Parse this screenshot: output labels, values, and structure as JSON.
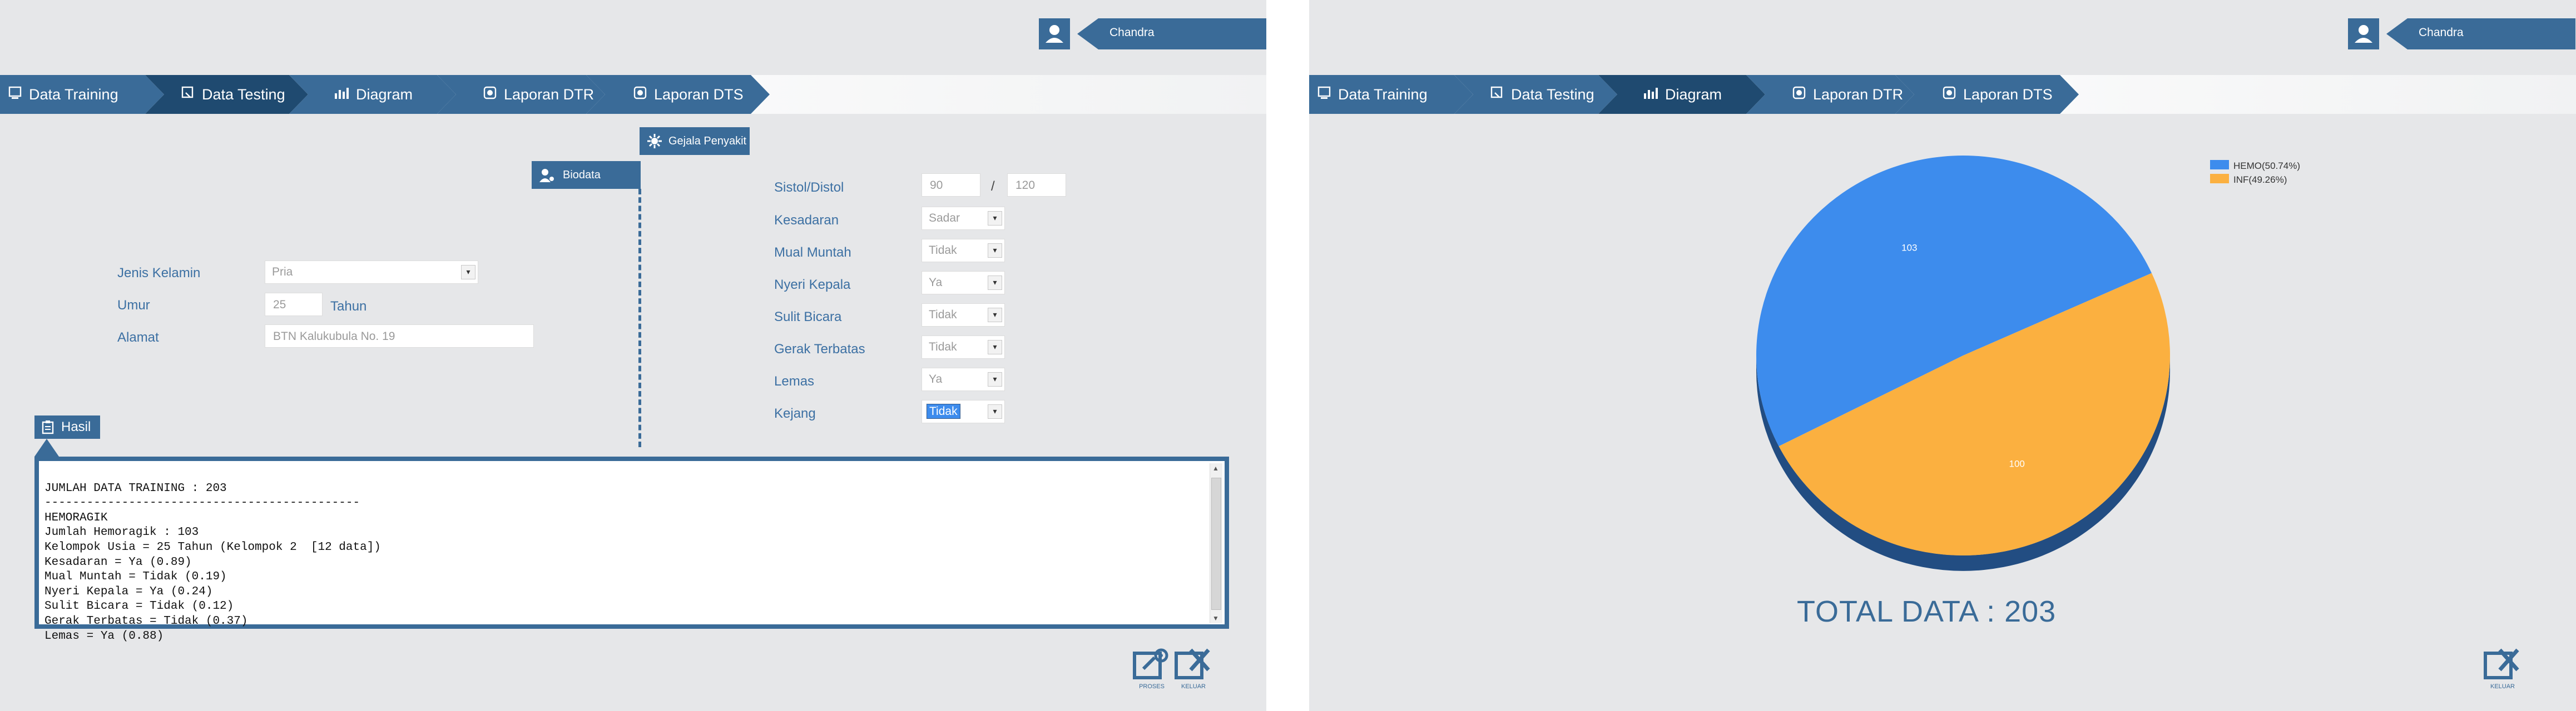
{
  "nav_tabs": [
    "Data Training",
    "Data Testing",
    "Diagram",
    "Laporan DTR",
    "Laporan DTS"
  ],
  "left": {
    "user": {
      "name": "Chandra"
    },
    "active_tab": "Data Testing",
    "biodata": {
      "tab_label": "Biodata",
      "jenis_kelamin_label": "Jenis Kelamin",
      "jenis_kelamin_value": "Pria",
      "umur_label": "Umur",
      "umur_value": "25",
      "umur_unit": "Tahun",
      "alamat_label": "Alamat",
      "alamat_value": "BTN Kalukubula No. 19"
    },
    "gejala": {
      "tab_label": "Gejala Penyakit",
      "sistol_label": "Sistol/Distol",
      "sistol_value": "90",
      "separator": "/",
      "distol_value": "120",
      "fields": [
        {
          "label": "Kesadaran",
          "value": "Sadar"
        },
        {
          "label": "Mual Muntah",
          "value": "Tidak"
        },
        {
          "label": "Nyeri Kepala",
          "value": "Ya"
        },
        {
          "label": "Sulit Bicara",
          "value": "Tidak"
        },
        {
          "label": "Gerak Terbatas",
          "value": "Tidak"
        },
        {
          "label": "Lemas",
          "value": "Ya"
        },
        {
          "label": "Kejang",
          "value": "Tidak"
        }
      ]
    },
    "hasil": {
      "tab_label": "Hasil",
      "lines": [
        "JUMLAH DATA TRAINING : 203",
        "---------------------------------------------",
        "HEMORAGIK",
        "Jumlah Hemoragik : 103",
        "Kelompok Usia = 25 Tahun (Kelompok 2  [12 data])",
        "Kesadaran = Ya (0.89)",
        "Mual Muntah = Tidak (0.19)",
        "Nyeri Kepala = Ya (0.24)",
        "Sulit Bicara = Tidak (0.12)",
        "Gerak Terbatas = Tidak (0.37)",
        "Lemas = Ya (0.88)"
      ]
    },
    "buttons": {
      "proses": "PROSES",
      "keluar": "KELUAR"
    }
  },
  "right": {
    "user": {
      "name": "Chandra"
    },
    "active_tab": "Diagram",
    "total_text": "TOTAL DATA : 203",
    "buttons": {
      "keluar": "KELUAR"
    }
  },
  "chart_data": {
    "type": "pie",
    "categories": [
      "HEMO",
      "INF"
    ],
    "values": [
      103,
      100
    ],
    "legend": [
      "HEMO(50.74%)",
      "INF(49.26%)"
    ],
    "colors": [
      "#3d8ced",
      "#fbb040"
    ],
    "legend_position": "top-right",
    "title": ""
  },
  "colors": {
    "accent": "#3a6b98",
    "active": "#1f4a70",
    "label": "#3c70a3",
    "background": "#e6e7e9"
  }
}
